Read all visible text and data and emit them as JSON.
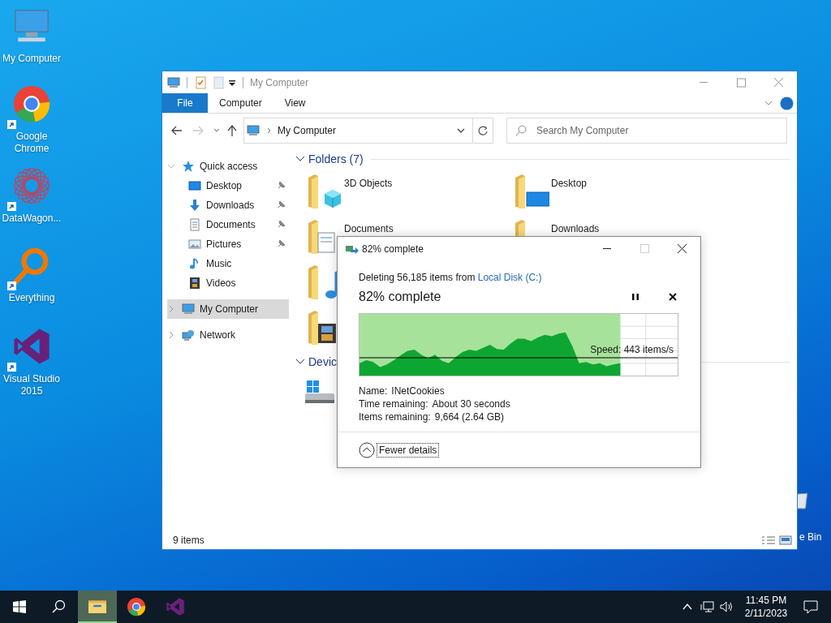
{
  "desktop_icons": [
    {
      "kind": "computer",
      "label": "My Computer"
    },
    {
      "kind": "chrome",
      "label": "Google Chrome",
      "shortcut": true
    },
    {
      "kind": "datawagon",
      "label": "DataWagon...",
      "shortcut": true
    },
    {
      "kind": "everything",
      "label": "Everything",
      "shortcut": true
    },
    {
      "kind": "vs",
      "label": "Visual Studio 2015",
      "shortcut": true
    },
    {
      "kind": "recycle",
      "label": "e Bin"
    }
  ],
  "explorer": {
    "title": "My Computer",
    "ribbon_tabs": [
      {
        "label": "File",
        "selected": true
      },
      {
        "label": "Computer",
        "selected": false
      },
      {
        "label": "View",
        "selected": false
      }
    ],
    "address": {
      "path": "My Computer"
    },
    "search": {
      "placeholder": "Search My Computer"
    },
    "nav": [
      {
        "kind": "quick",
        "label": "Quick access",
        "expanded": true,
        "selected": false,
        "children": [
          {
            "kind": "desktop",
            "label": "Desktop",
            "pinned": true
          },
          {
            "kind": "downloads",
            "label": "Downloads",
            "pinned": true
          },
          {
            "kind": "documents",
            "label": "Documents",
            "pinned": true
          },
          {
            "kind": "pictures",
            "label": "Pictures",
            "pinned": true
          },
          {
            "kind": "music",
            "label": "Music",
            "pinned": false
          },
          {
            "kind": "videos",
            "label": "Videos",
            "pinned": false
          }
        ]
      },
      {
        "kind": "computer",
        "label": "My Computer",
        "expanded": false,
        "selected": true
      },
      {
        "kind": "network",
        "label": "Network",
        "expanded": false,
        "selected": false
      }
    ],
    "sections": [
      {
        "kind": "folders",
        "title": "Folders (7)",
        "expanded": true,
        "columns": [
          [
            {
              "kind": "cube",
              "label": "3D Objects"
            },
            {
              "kind": "documents",
              "label": "Documents"
            },
            {
              "kind": "music"
            },
            {
              "kind": "videos"
            }
          ],
          [
            {
              "kind": "desktop",
              "label": "Desktop"
            },
            {
              "kind": "downloads",
              "label": "Downloads"
            }
          ]
        ]
      },
      {
        "kind": "devices",
        "title": "Devic",
        "expanded": true
      }
    ],
    "status": "9 items"
  },
  "dialog": {
    "title": "82% complete",
    "summary": "Deleting 56,185 items from",
    "source_link": "Local Disk (C:)",
    "headline": "82% complete",
    "progress": {
      "level": 0.82,
      "speed": "Speed: 443 items/s"
    },
    "details": [
      {
        "label": "Name:",
        "value": "INetCookies"
      },
      {
        "label": "Time remaining:",
        "value": "About 30 seconds"
      },
      {
        "label": "Items remaining:",
        "value": "9,664 (2.64 GB)"
      }
    ],
    "toggle": {
      "label": "Fewer details",
      "expanded": true
    }
  },
  "taskbar": {
    "apps": [
      {
        "kind": "explorer",
        "selected": true
      },
      {
        "kind": "chrome",
        "selected": false
      },
      {
        "kind": "vs",
        "selected": false
      }
    ],
    "time": "11:45 PM",
    "date": "2/11/2023"
  }
}
